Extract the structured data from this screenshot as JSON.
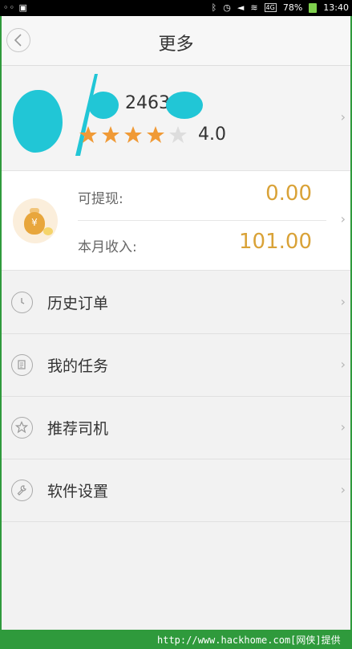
{
  "status_bar": {
    "left": "◦◦ ▣",
    "network": "4G",
    "battery": "78%",
    "time": "13:40"
  },
  "header": {
    "title": "更多"
  },
  "profile": {
    "driver_id_partial": "2463",
    "rating": "4.0",
    "stars_filled": 4,
    "stars_total": 5
  },
  "income": {
    "withdrawable_label": "可提现:",
    "withdrawable_value": "0.00",
    "monthly_label": "本月收入:",
    "monthly_value": "101.00",
    "currency_icon": "yen-moneybag-icon"
  },
  "menu": [
    {
      "label": "历史订单",
      "icon": "clock-icon"
    },
    {
      "label": "我的任务",
      "icon": "task-list-icon"
    },
    {
      "label": "推荐司机",
      "icon": "star-outline-icon"
    },
    {
      "label": "软件设置",
      "icon": "wrench-icon"
    }
  ],
  "footer": {
    "watermark": "http://www.hackhome.com[网侠]提供"
  },
  "colors": {
    "accent_gold": "#d9a237",
    "star": "#f09a36",
    "star_empty": "#dddddd",
    "redact": "#21c6d6",
    "frame": "#2f9a3c"
  }
}
